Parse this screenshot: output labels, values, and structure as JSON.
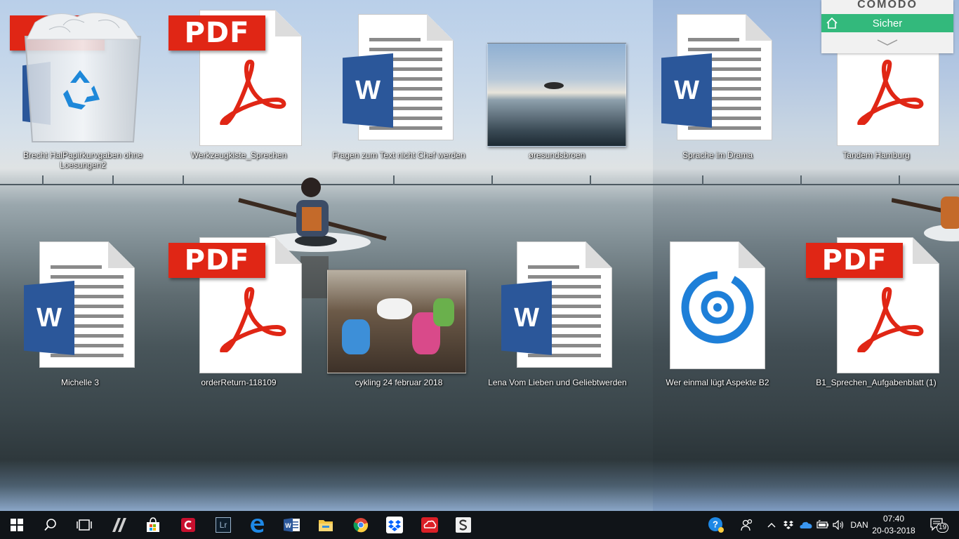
{
  "desktop": {
    "icons": [
      {
        "label": "Brecht HalPapirkurvgaben ohne Loesungen2",
        "type": "recycle"
      },
      {
        "label": "Werkzeugkiste_Sprechen",
        "type": "pdf"
      },
      {
        "label": "Fragen zum Text nicht Chef werden",
        "type": "word"
      },
      {
        "label": "øresundsbroen",
        "type": "photo-kayak"
      },
      {
        "label": "Sprache im Drama",
        "type": "word"
      },
      {
        "label": "Tandem Hamburg",
        "type": "pdf"
      },
      {
        "label": "Michelle 3",
        "type": "word"
      },
      {
        "label": "orderReturn-118109",
        "type": "pdf"
      },
      {
        "label": "cykling 24 februar 2018",
        "type": "photo-group"
      },
      {
        "label": "Lena  Vom Lieben und Geliebtwerden",
        "type": "word"
      },
      {
        "label": "Wer einmal lügt Aspekte B2",
        "type": "groove"
      },
      {
        "label": "B1_Sprechen_Aufgabenblatt (1)",
        "type": "pdf"
      }
    ],
    "pdf_text": "PDF",
    "word_letter": "W"
  },
  "comodo": {
    "brand": "COMODO",
    "status": "Sicher",
    "accent": "#33b97c"
  },
  "taskbar": {
    "apps": [
      {
        "name": "start-icon"
      },
      {
        "name": "search-icon"
      },
      {
        "name": "task-view-icon"
      },
      {
        "name": "hp-icon"
      },
      {
        "name": "store-icon"
      },
      {
        "name": "comodo-icon"
      },
      {
        "name": "lightroom-icon",
        "text": "Lr"
      },
      {
        "name": "edge-icon"
      },
      {
        "name": "word-icon"
      },
      {
        "name": "file-explorer-icon"
      },
      {
        "name": "chrome-icon"
      },
      {
        "name": "dropbox-icon"
      },
      {
        "name": "creative-cloud-icon"
      },
      {
        "name": "app-s-icon"
      }
    ],
    "language": "DAN",
    "time": "07:40",
    "date": "20-03-2018",
    "notifications": "19"
  }
}
